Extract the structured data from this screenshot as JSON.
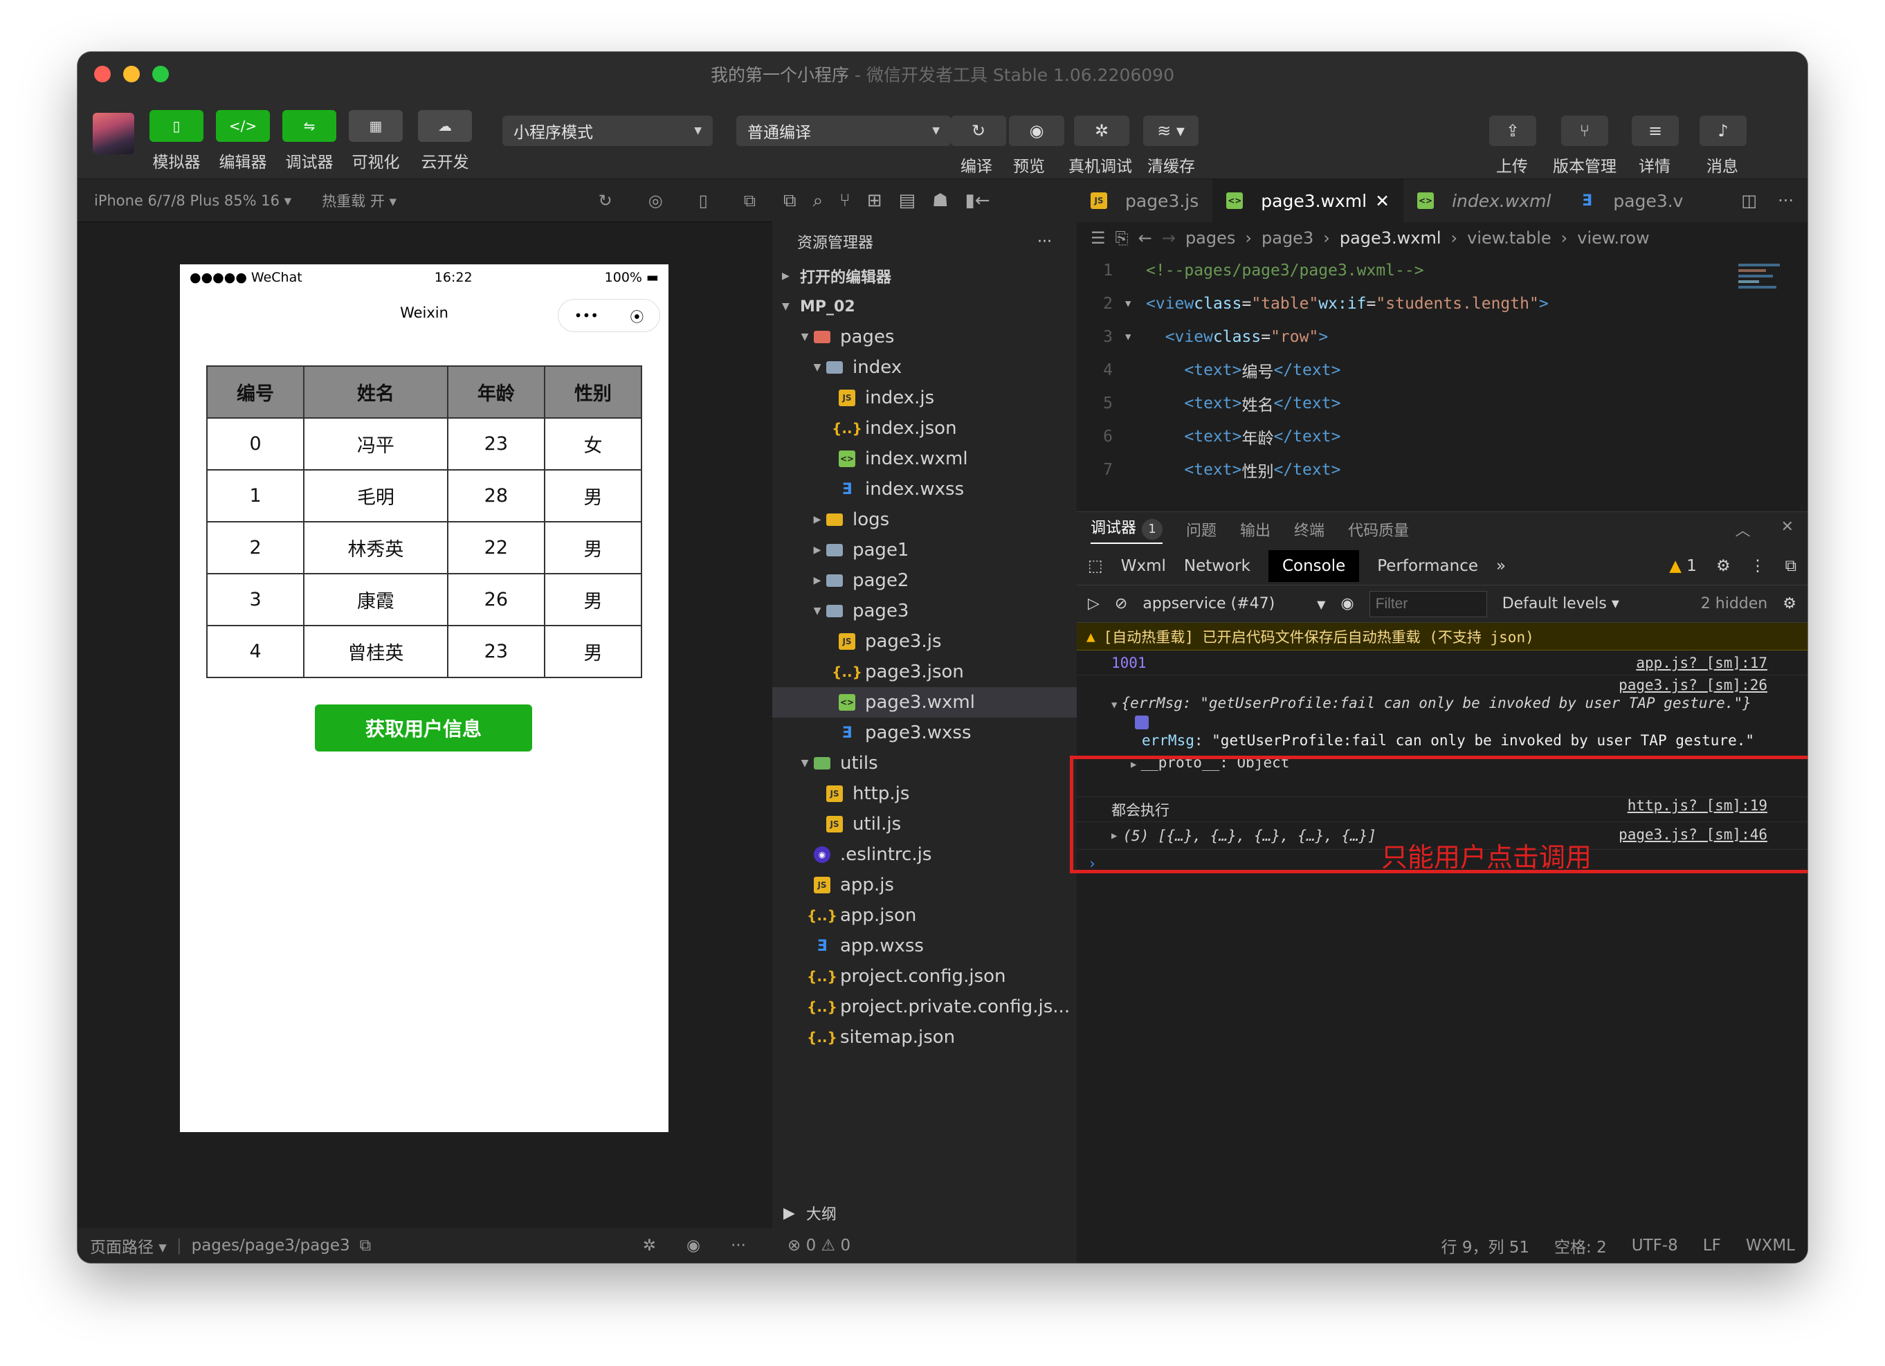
{
  "window": {
    "title": "我的第一个小程序",
    "app": " - 微信开发者工具 Stable 1.06.2206090"
  },
  "toolbar": {
    "simulator": "模拟器",
    "editor": "编辑器",
    "debugger": "调试器",
    "visual": "可视化",
    "cloud": "云开发",
    "mode": "小程序模式",
    "compile_mode": "普通编译",
    "compile": "编译",
    "preview": "预览",
    "remote_debug": "真机调试",
    "clear_cache": "清缓存",
    "upload": "上传",
    "version": "版本管理",
    "details": "详情",
    "messages": "消息"
  },
  "sim": {
    "device": "iPhone 6/7/8 Plus 85% 16 ▾",
    "hotreload": "热重载 开 ▾"
  },
  "phone": {
    "carrier": "●●●●● WeChat",
    "time": "16:22",
    "battery": "100%",
    "nav_title": "Weixin",
    "capsule_dots": "•••"
  },
  "table": {
    "headers": [
      "编号",
      "姓名",
      "年龄",
      "性别"
    ],
    "rows": [
      [
        "0",
        "冯平",
        "23",
        "女"
      ],
      [
        "1",
        "毛明",
        "28",
        "男"
      ],
      [
        "2",
        "林秀英",
        "22",
        "男"
      ],
      [
        "3",
        "康霞",
        "26",
        "男"
      ],
      [
        "4",
        "曾桂英",
        "23",
        "男"
      ]
    ]
  },
  "button": {
    "get_user": "获取用户信息"
  },
  "explorer": {
    "title": "资源管理器",
    "more": "···",
    "open_editors": "打开的编辑器",
    "project": "MP_02",
    "outline": "大纲",
    "tree": [
      {
        "label": "pages",
        "icon": "folder-red",
        "level": 1,
        "tw": "▼"
      },
      {
        "label": "index",
        "icon": "folder",
        "level": 2,
        "tw": "▼"
      },
      {
        "label": "index.js",
        "icon": "js",
        "level": 3,
        "tw": ""
      },
      {
        "label": "index.json",
        "icon": "json",
        "level": 3,
        "tw": ""
      },
      {
        "label": "index.wxml",
        "icon": "wxml",
        "level": 3,
        "tw": ""
      },
      {
        "label": "index.wxss",
        "icon": "wxss",
        "level": 3,
        "tw": ""
      },
      {
        "label": "logs",
        "icon": "folder-log",
        "level": 2,
        "tw": "▶"
      },
      {
        "label": "page1",
        "icon": "folder",
        "level": 2,
        "tw": "▶"
      },
      {
        "label": "page2",
        "icon": "folder",
        "level": 2,
        "tw": "▶"
      },
      {
        "label": "page3",
        "icon": "folder",
        "level": 2,
        "tw": "▼"
      },
      {
        "label": "page3.js",
        "icon": "js",
        "level": 3,
        "tw": ""
      },
      {
        "label": "page3.json",
        "icon": "json",
        "level": 3,
        "tw": ""
      },
      {
        "label": "page3.wxml",
        "icon": "wxml",
        "level": 3,
        "tw": "",
        "selected": true
      },
      {
        "label": "page3.wxss",
        "icon": "wxss",
        "level": 3,
        "tw": ""
      },
      {
        "label": "utils",
        "icon": "folder-green",
        "level": 1,
        "tw": "▼"
      },
      {
        "label": "http.js",
        "icon": "js",
        "level": 2,
        "tw": ""
      },
      {
        "label": "util.js",
        "icon": "js",
        "level": 2,
        "tw": ""
      },
      {
        "label": ".eslintrc.js",
        "icon": "eslint",
        "level": 1,
        "tw": ""
      },
      {
        "label": "app.js",
        "icon": "js",
        "level": 1,
        "tw": ""
      },
      {
        "label": "app.json",
        "icon": "json",
        "level": 1,
        "tw": ""
      },
      {
        "label": "app.wxss",
        "icon": "wxss",
        "level": 1,
        "tw": ""
      },
      {
        "label": "project.config.json",
        "icon": "json",
        "level": 1,
        "tw": ""
      },
      {
        "label": "project.private.config.js...",
        "icon": "json",
        "level": 1,
        "tw": ""
      },
      {
        "label": "sitemap.json",
        "icon": "json",
        "level": 1,
        "tw": ""
      }
    ]
  },
  "editor": {
    "tabs": [
      "page3.js",
      "page3.wxml",
      "index.wxml",
      "page3.v"
    ],
    "breadcrumb": [
      "pages",
      "page3",
      "page3.wxml",
      "view.table",
      "view.row"
    ]
  },
  "debugger": {
    "tabs": [
      "调试器",
      "问题",
      "输出",
      "终端",
      "代码质量"
    ],
    "badge": "1",
    "devtabs": [
      "Wxml",
      "Network",
      "Console",
      "Performance"
    ],
    "warn_count": "1",
    "context": "appservice (#47)",
    "filter": "Filter",
    "levels": "Default levels ▾",
    "hidden": "2 hidden",
    "warning": "[自动热重载] 已开启代码文件保存后自动热重载 (不支持 json)",
    "log_value": "1001",
    "log_src": "app.js? [sm]:17",
    "err_src": "page3.js? [sm]:26",
    "err_summary": "{errMsg: \"getUserProfile:fail can only be invoked by user TAP gesture.\"}",
    "err_key": "errMsg",
    "err_msg": "\"getUserProfile:fail can only be invoked by user TAP gesture.\"",
    "proto": "__proto__: Object",
    "row_exec": "都会执行",
    "row_exec_src": "http.js? [sm]:19",
    "array": "(5) [{…}, {…}, {…}, {…}, {…}]",
    "array_src": "page3.js? [sm]:46",
    "annotation": "只能用户点击调用"
  },
  "statusbar": {
    "page_path": "页面路径 ▾",
    "path": "pages/page3/page3",
    "errors": "⊗ 0 ⚠ 0",
    "pos": "行 9，列 51",
    "spaces": "空格: 2",
    "encoding": "UTF-8",
    "eol": "LF",
    "lang": "WXML"
  }
}
